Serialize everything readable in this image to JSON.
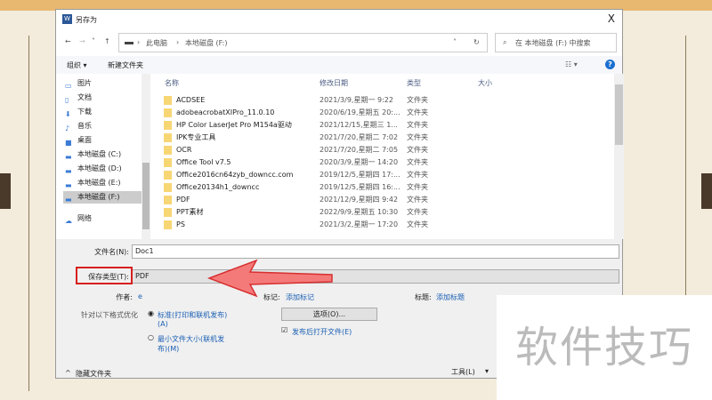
{
  "dialog": {
    "title": "另存为",
    "close": "X"
  },
  "nav": {
    "back": "←",
    "forward": "→",
    "recent": "˅",
    "up": "↑",
    "breadcrumb": [
      "此电脑",
      "本地磁盘 (F:)"
    ],
    "separator": "›",
    "dropdown": "˅",
    "refresh": "↻",
    "search_placeholder": "在 本地磁盘 (F:) 中搜索"
  },
  "toolbar": {
    "organize": "组织 ▾",
    "new_folder": "新建文件夹",
    "view": "☷ ▾",
    "help": "?"
  },
  "sidebar": [
    {
      "label": "图片",
      "icon": "picture-icon"
    },
    {
      "label": "文档",
      "icon": "document-icon"
    },
    {
      "label": "下载",
      "icon": "download-icon"
    },
    {
      "label": "音乐",
      "icon": "music-icon"
    },
    {
      "label": "桌面",
      "icon": "desktop-icon"
    },
    {
      "label": "本地磁盘 (C:)",
      "icon": "drive-icon"
    },
    {
      "label": "本地磁盘 (D:)",
      "icon": "drive-icon"
    },
    {
      "label": "本地磁盘 (E:)",
      "icon": "drive-icon"
    },
    {
      "label": "本地磁盘 (F:)",
      "icon": "drive-icon"
    },
    {
      "label": "网络",
      "icon": "network-icon"
    }
  ],
  "columns": {
    "name": "名称",
    "date": "修改日期",
    "type": "类型",
    "size": "大小"
  },
  "files": [
    {
      "name": "ACDSEE",
      "date": "2021/3/9,星期一 9:22",
      "type": "文件夹"
    },
    {
      "name": "adobeacrobatXIPro_11.0.10",
      "date": "2020/6/19,星期五 20:...",
      "type": "文件夹"
    },
    {
      "name": "HP Color LaserJet Pro M154a驱动",
      "date": "2021/12/15,星期三 1...",
      "type": "文件夹"
    },
    {
      "name": "IPK专业工具",
      "date": "2021/7/20,星期二 7:02",
      "type": "文件夹"
    },
    {
      "name": "OCR",
      "date": "2021/7/20,星期二 7:05",
      "type": "文件夹"
    },
    {
      "name": "Office Tool v7.5",
      "date": "2020/3/9,星期一 14:20",
      "type": "文件夹"
    },
    {
      "name": "Office2016cn64zyb_downcc.com",
      "date": "2019/12/5,星期四 17:...",
      "type": "文件夹"
    },
    {
      "name": "Office20134h1_downcc",
      "date": "2019/12/5,星期四 16:...",
      "type": "文件夹"
    },
    {
      "name": "PDF",
      "date": "2021/12/9,星期四 9:42",
      "type": "文件夹"
    },
    {
      "name": "PPT素材",
      "date": "2022/9/9,星期五 10:30",
      "type": "文件夹"
    },
    {
      "name": "PS",
      "date": "2021/3/2,星期一 17:20",
      "type": "文件夹"
    }
  ],
  "form": {
    "filename_label": "文件名(N):",
    "filename": "Doc1",
    "type_label": "保存类型(T):",
    "type": "PDF",
    "author_label": "作者:",
    "author": "e",
    "tags_label": "标记:",
    "tags": "添加标记",
    "title_label": "标题:",
    "title": "添加标题",
    "optimize_label": "针对以下格式优化",
    "opt_standard": "标准(打印和联机发布)",
    "opt_standard_key": "(A)",
    "opt_min": "最小文件大小(联机发",
    "opt_min_key": "布)(M)",
    "options_btn": "选项(O)...",
    "open_after": "发布后打开文件(E)",
    "hide_folders": "隐藏文件夹",
    "tools": "工具(L)"
  },
  "watermark": "软件技巧",
  "colors": {
    "highlight": "#d81e1e",
    "arrow": "#f47a7a"
  }
}
